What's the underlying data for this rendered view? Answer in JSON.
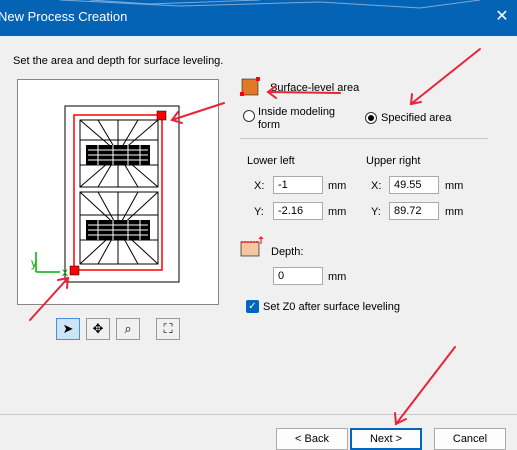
{
  "window": {
    "title": "New Process Creation"
  },
  "instructions": "Set the area and depth for surface leveling.",
  "area": {
    "title": "Surface-level area",
    "option_inside": "Inside modeling form",
    "option_specified": "Specified area",
    "selected": "Specified area"
  },
  "lower_left": {
    "title": "Lower left",
    "x_label": "X:",
    "x_value": "-1",
    "y_label": "Y:",
    "y_value": "-2.16",
    "unit": "mm"
  },
  "upper_right": {
    "title": "Upper right",
    "x_label": "X:",
    "x_value": "49.55",
    "y_label": "Y:",
    "y_value": "89.72",
    "unit": "mm"
  },
  "depth": {
    "label": "Depth:",
    "value": "0",
    "unit": "mm"
  },
  "set_z0": {
    "label": "Set Z0 after surface leveling",
    "checked": true
  },
  "preview": {
    "axis_y": "y",
    "axis_x": "x"
  },
  "tools": [
    {
      "name": "select",
      "icon": "arrow-pointer-icon"
    },
    {
      "name": "pan",
      "icon": "move-cross-icon"
    },
    {
      "name": "zoom",
      "icon": "magnifier-icon"
    },
    {
      "name": "fit",
      "icon": "fit-frame-icon"
    }
  ],
  "buttons": {
    "back": "< Back",
    "next": "Next >",
    "cancel": "Cancel"
  },
  "colors": {
    "titlebar": "#0563b6",
    "accent": "#0067c0",
    "selection": "#ff0000",
    "annotation": "#e8233a"
  }
}
